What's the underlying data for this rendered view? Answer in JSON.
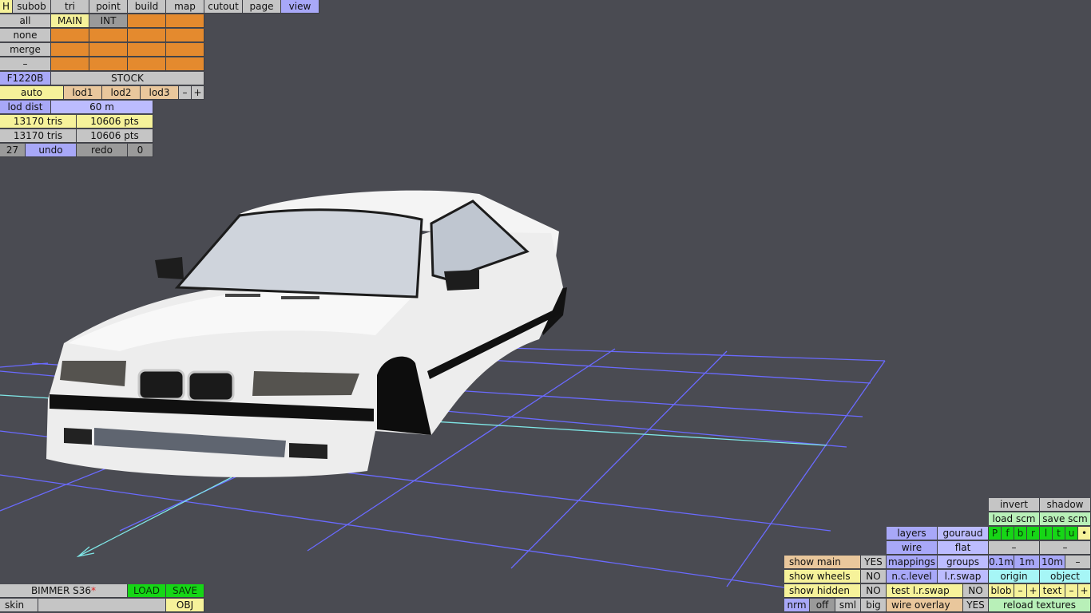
{
  "top_menu": [
    "H",
    "subob",
    "tri",
    "point",
    "build",
    "map",
    "cutout",
    "page",
    "view"
  ],
  "subob_panel": {
    "rows": [
      "all",
      "none",
      "merge",
      "–"
    ],
    "main_label": "MAIN",
    "int_label": "INT"
  },
  "model_code": "F1220B",
  "variant": "STOCK",
  "lod": {
    "auto": "auto",
    "lod1": "lod1",
    "lod2": "lod2",
    "lod3": "lod3",
    "minus": "–",
    "plus": "+"
  },
  "lod_dist": {
    "label": "lod dist",
    "value": "60 m"
  },
  "stats": [
    {
      "tris": "13170 tris",
      "pts": "10606 pts"
    },
    {
      "tris": "13170 tris",
      "pts": "10606 pts"
    }
  ],
  "undo_bar": {
    "count": "27",
    "undo": "undo",
    "redo": "redo",
    "redo_count": "0"
  },
  "file": {
    "name": "BIMMER S36",
    "modified_mark": "*",
    "load": "LOAD",
    "save": "SAVE",
    "skin": "skin",
    "obj": "OBJ"
  },
  "view_panel": {
    "invert": "invert",
    "shadow": "shadow",
    "load_scm": "load scm",
    "save_scm": "save scm",
    "letters": [
      "P",
      "f",
      "b",
      "r",
      "l",
      "t",
      "u",
      "•"
    ],
    "layers": "layers",
    "gouraud": "gouraud",
    "wire": "wire",
    "flat": "flat",
    "dash1": "–",
    "dash2": "–",
    "show_main": "show main",
    "show_main_val": "YES",
    "mappings": "mappings",
    "groups": "groups",
    "scale_1": "0.1m",
    "scale_2": "1m",
    "scale_3": "10m",
    "scale_minus": "–",
    "show_wheels": "show wheels",
    "show_wheels_val": "NO",
    "nc_level": "n.c.level",
    "lr_swap": "l.r.swap",
    "origin": "origin",
    "object": "object",
    "show_hidden": "show hidden",
    "show_hidden_val": "NO",
    "test_lr_swap": "test l.r.swap",
    "test_lr_swap_val": "NO",
    "blob": "blob",
    "text": "text",
    "minus": "–",
    "plus": "+",
    "nrm": "nrm",
    "off": "off",
    "sml": "sml",
    "big": "big",
    "wire_overlay": "wire overlay",
    "wire_overlay_val": "YES",
    "reload_textures": "reload textures"
  },
  "colors": {
    "background": "#4a4b52",
    "grid": "#6b6bff",
    "axis": "#7fe6e6",
    "car_body": "#f2f2f2"
  }
}
